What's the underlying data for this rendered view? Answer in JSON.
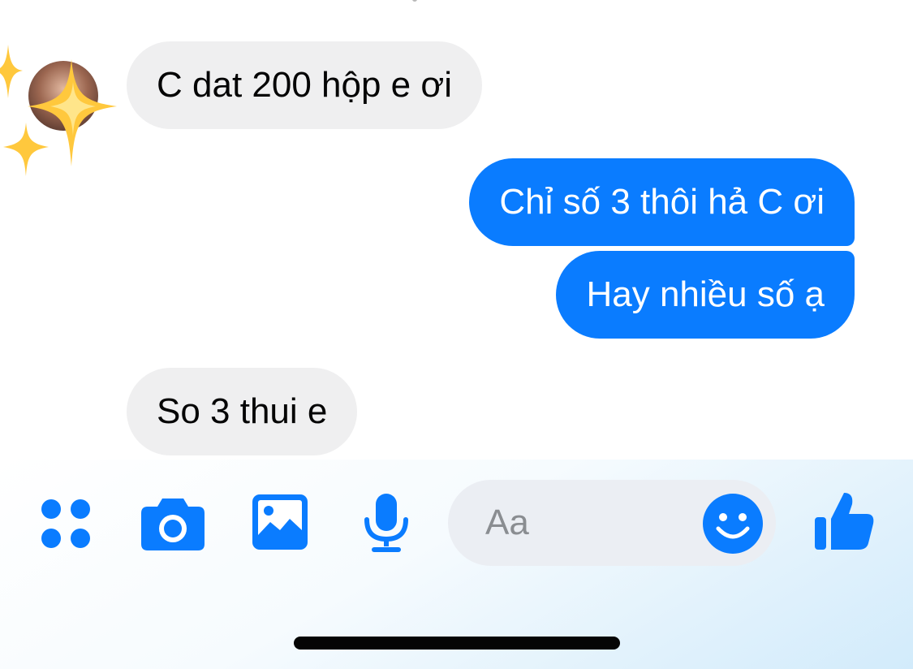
{
  "messages": [
    {
      "direction": "incoming",
      "text": "C dat 200 hộp e ơi"
    },
    {
      "direction": "outgoing",
      "text": "Chỉ số 3 thôi hả C ơi"
    },
    {
      "direction": "outgoing",
      "text": "Hay nhiều số ạ"
    },
    {
      "direction": "incoming",
      "text": "So 3 thui e"
    }
  ],
  "composer": {
    "placeholder": "Aa",
    "icons": [
      "apps-icon",
      "camera-icon",
      "gallery-icon",
      "microphone-icon",
      "emoji-icon",
      "thumbs-up-icon"
    ]
  },
  "colors": {
    "accent": "#0a7cff",
    "incoming_bubble": "#efeff0",
    "outgoing_text": "#ffffff",
    "sparkle": "#ffc83d"
  }
}
